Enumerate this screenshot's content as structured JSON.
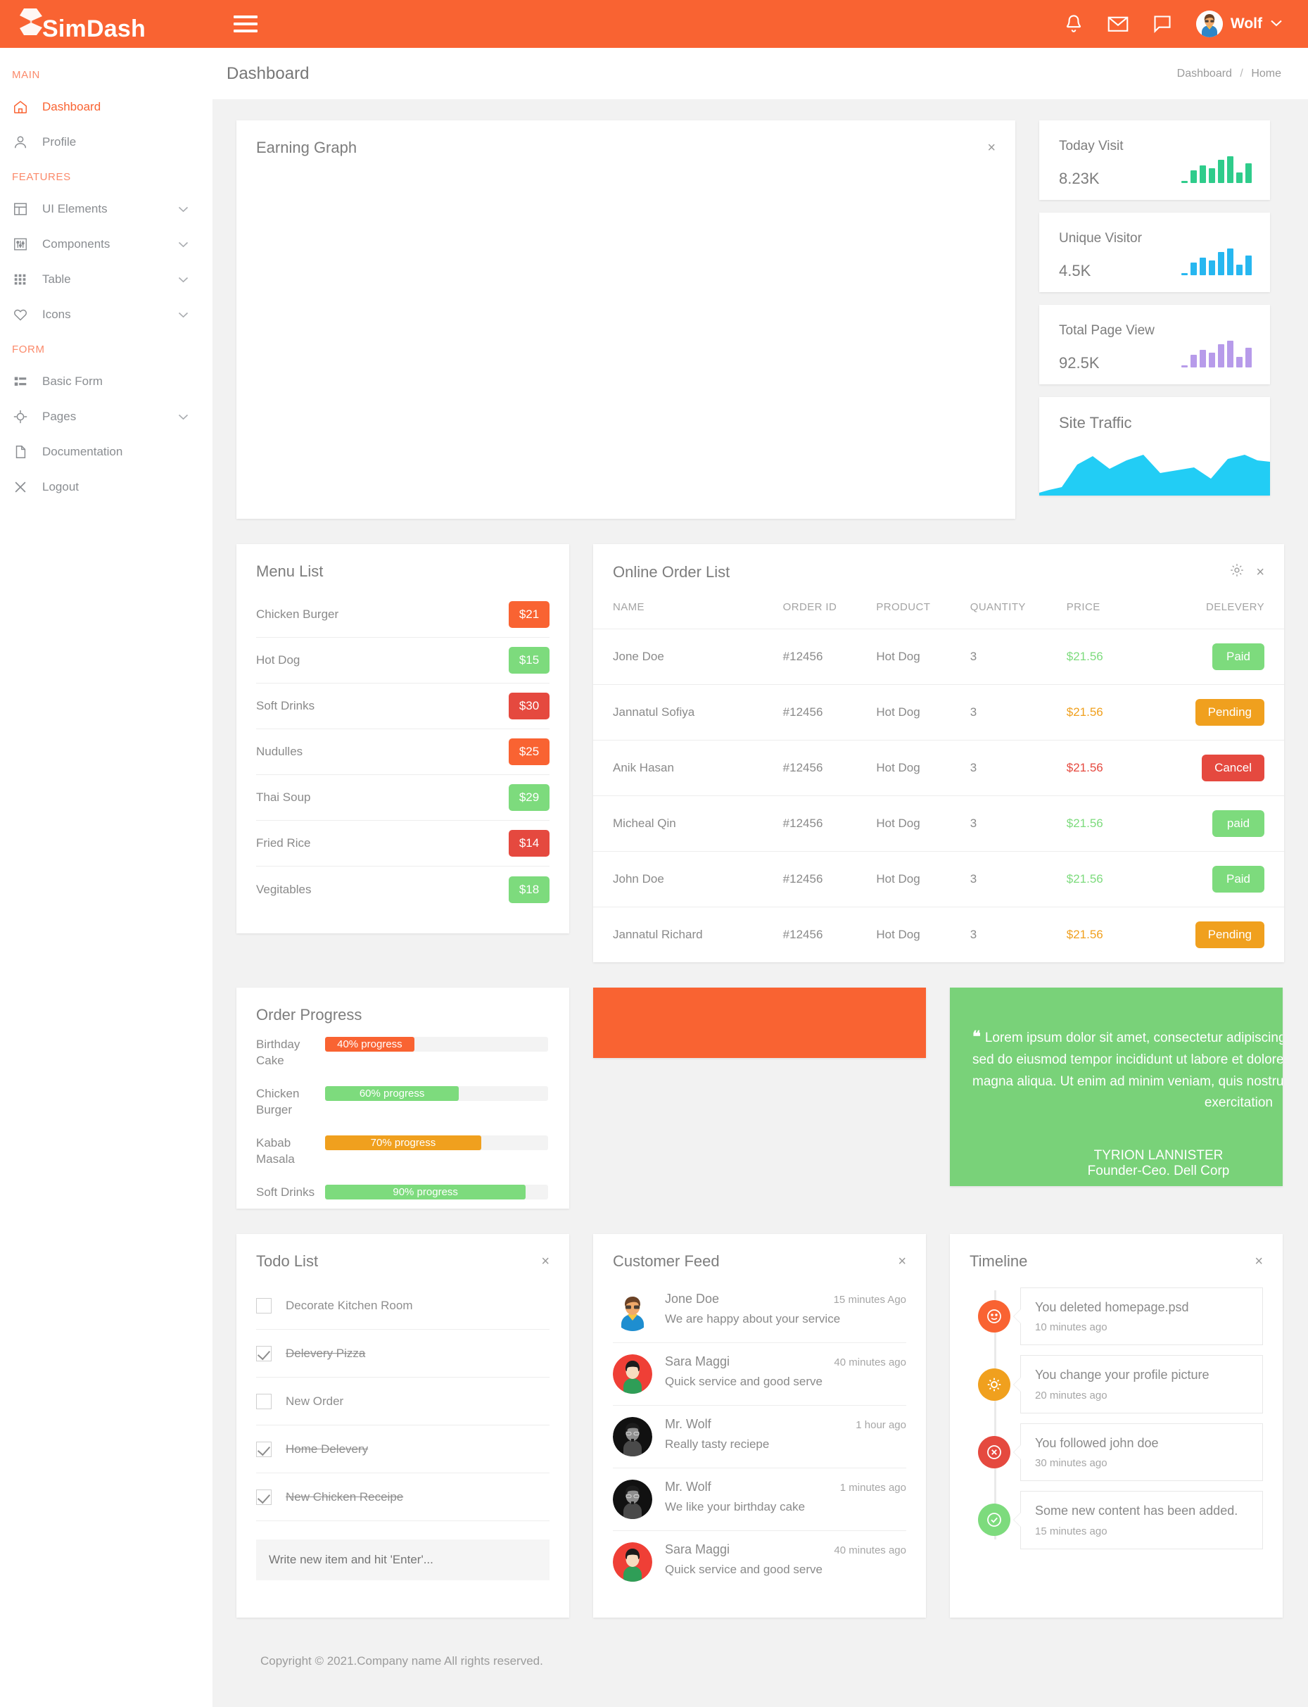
{
  "brand": {
    "logo_first": "Sim",
    "logo_second": "Dash"
  },
  "topbar": {
    "menu_icon": "hamburger-icon",
    "bell_icon": "bell-icon",
    "mail_icon": "mail-icon",
    "chat_icon": "chat-icon",
    "user_name": "Wolf",
    "caret": "∨"
  },
  "sidebar": {
    "sections": [
      {
        "label": "MAIN",
        "items": [
          {
            "label": "Dashboard",
            "icon": "home-icon",
            "active": true,
            "chevron": false
          },
          {
            "label": "Profile",
            "icon": "user-icon",
            "active": false,
            "chevron": false
          }
        ]
      },
      {
        "label": "FEATURES",
        "items": [
          {
            "label": "UI Elements",
            "icon": "layout-icon",
            "active": false,
            "chevron": true
          },
          {
            "label": "Components",
            "icon": "sliders-icon",
            "active": false,
            "chevron": true
          },
          {
            "label": "Table",
            "icon": "grid-icon",
            "active": false,
            "chevron": true
          },
          {
            "label": "Icons",
            "icon": "heart-icon",
            "active": false,
            "chevron": true
          }
        ]
      },
      {
        "label": "FORM",
        "items": [
          {
            "label": "Basic Form",
            "icon": "form-icon",
            "active": false,
            "chevron": false
          },
          {
            "label": "Pages",
            "icon": "target-icon",
            "active": false,
            "chevron": true
          },
          {
            "label": "Documentation",
            "icon": "document-icon",
            "active": false,
            "chevron": false
          },
          {
            "label": "Logout",
            "icon": "close-icon",
            "active": false,
            "chevron": false
          }
        ]
      }
    ]
  },
  "page": {
    "title": "Dashboard",
    "breadcrumb": {
      "parent": "Dashboard",
      "sep": "/",
      "current": "Home"
    }
  },
  "earning_graph": {
    "title": "Earning Graph",
    "close": "×"
  },
  "stats": [
    {
      "label": "Today Visit",
      "value": "8.23K",
      "color": "#2fcc8b"
    },
    {
      "label": "Unique Visitor",
      "value": "4.5K",
      "color": "#27b7f0"
    },
    {
      "label": "Total Page View",
      "value": "92.5K",
      "color": "#b79bea"
    }
  ],
  "site_traffic": {
    "title": "Site Traffic",
    "color": "#22cdf5"
  },
  "menu_list": {
    "title": "Menu List",
    "items": [
      {
        "name": "Chicken Burger",
        "price": "$21",
        "color": "#f96332"
      },
      {
        "name": "Hot Dog",
        "price": "$15",
        "color": "#7ddb7d"
      },
      {
        "name": "Soft Drinks",
        "price": "$30",
        "color": "#e5493f"
      },
      {
        "name": "Nudulles",
        "price": "$25",
        "color": "#f96332"
      },
      {
        "name": "Thai Soup",
        "price": "$29",
        "color": "#7ddb7d"
      },
      {
        "name": "Fried Rice",
        "price": "$14",
        "color": "#e5493f"
      },
      {
        "name": "Vegitables",
        "price": "$18",
        "color": "#7ddb7d"
      }
    ]
  },
  "order_list": {
    "title": "Online Order List",
    "gear_icon": "gear-icon",
    "close": "×",
    "columns": [
      "NAME",
      "ORDER ID",
      "PRODUCT",
      "QUANTITY",
      "PRICE",
      "DELEVERY"
    ],
    "rows": [
      {
        "name": "Jone Doe",
        "order_id": "#12456",
        "product": "Hot Dog",
        "quantity": "3",
        "price": "$21.56",
        "price_color": "#7ddb7d",
        "status": "Paid",
        "status_color": "#7ddb7d"
      },
      {
        "name": "Jannatul Sofiya",
        "order_id": "#12456",
        "product": "Hot Dog",
        "quantity": "3",
        "price": "$21.56",
        "price_color": "#f0a01e",
        "status": "Pending",
        "status_color": "#f0a01e"
      },
      {
        "name": "Anik Hasan",
        "order_id": "#12456",
        "product": "Hot Dog",
        "quantity": "3",
        "price": "$21.56",
        "price_color": "#e5493f",
        "status": "Cancel",
        "status_color": "#e5493f"
      },
      {
        "name": "Micheal Qin",
        "order_id": "#12456",
        "product": "Hot Dog",
        "quantity": "3",
        "price": "$21.56",
        "price_color": "#7ddb7d",
        "status": "paid",
        "status_color": "#7ddb7d"
      },
      {
        "name": "John Doe",
        "order_id": "#12456",
        "product": "Hot Dog",
        "quantity": "3",
        "price": "$21.56",
        "price_color": "#7ddb7d",
        "status": "Paid",
        "status_color": "#7ddb7d"
      },
      {
        "name": "Jannatul Richard",
        "order_id": "#12456",
        "product": "Hot Dog",
        "quantity": "3",
        "price": "$21.56",
        "price_color": "#f0a01e",
        "status": "Pending",
        "status_color": "#f0a01e"
      }
    ]
  },
  "order_progress": {
    "title": "Order Progress",
    "items": [
      {
        "label": "Birthday Cake",
        "text": "40% progress",
        "percent": 40,
        "color": "#f96332"
      },
      {
        "label": "Chicken Burger",
        "text": "60% progress",
        "percent": 60,
        "color": "#7ddb7d"
      },
      {
        "label": "Kabab Masala",
        "text": "70% progress",
        "percent": 70,
        "color": "#f0a01e"
      },
      {
        "label": "Soft Drinks",
        "text": "90% progress",
        "percent": 90,
        "color": "#7ddb7d"
      }
    ]
  },
  "quote": {
    "mark": "“",
    "line1": "Lorem ipsum dolor sit amet, consectetur adipiscing elit,",
    "line2": "sed do eiusmod tempor incididunt ut labore et dolore",
    "line3": "magna aliqua. Ut enim ad minim veniam, quis nostrud",
    "line4": "exercitation",
    "author": "TYRION LANNISTER",
    "role": "Founder-Ceo. Dell Corp"
  },
  "todo": {
    "title": "Todo List",
    "close": "×",
    "items": [
      {
        "text": "Decorate Kitchen Room",
        "checked": false
      },
      {
        "text": "Delevery Pizza",
        "checked": true
      },
      {
        "text": "New Order",
        "checked": false
      },
      {
        "text": "Home Delevery",
        "checked": true
      },
      {
        "text": "New Chicken Receipe",
        "checked": true
      }
    ],
    "input_placeholder": "Write new item and hit 'Enter'...",
    "input_value": ""
  },
  "customer_feed": {
    "title": "Customer Feed",
    "close": "×",
    "items": [
      {
        "name": "Jone Doe",
        "time": "15 minutes Ago",
        "message": "We are happy about your service",
        "avatar": "avatar-glasses-blue"
      },
      {
        "name": "Sara Maggi",
        "time": "40 minutes ago",
        "message": "Quick service and good serve",
        "avatar": "avatar-red"
      },
      {
        "name": "Mr. Wolf",
        "time": "1 hour ago",
        "message": "Really tasty reciepe",
        "avatar": "avatar-dark"
      },
      {
        "name": "Mr. Wolf",
        "time": "1 minutes ago",
        "message": "We like your birthday cake",
        "avatar": "avatar-dark"
      },
      {
        "name": "Sara Maggi",
        "time": "40 minutes ago",
        "message": "Quick service and good serve",
        "avatar": "avatar-red"
      }
    ]
  },
  "timeline": {
    "title": "Timeline",
    "close": "×",
    "items": [
      {
        "title": "You deleted homepage.psd",
        "time": "10 minutes ago",
        "color": "#f96332",
        "icon": "smiley-icon"
      },
      {
        "title": "You change your profile picture",
        "time": "20 minutes ago",
        "color": "#f0a01e",
        "icon": "sun-icon"
      },
      {
        "title": "You followed john doe",
        "time": "30 minutes ago",
        "color": "#e5493f",
        "icon": "close-circle-icon"
      },
      {
        "title": "Some new content has been added.",
        "time": "15 minutes ago",
        "color": "#7ddb7d",
        "icon": "check-circle-icon"
      }
    ]
  },
  "footer": {
    "text": "Copyright © 2021.Company name All rights reserved."
  },
  "chart_data": [
    {
      "type": "bar",
      "title": "Today Visit",
      "values": [
        4,
        22,
        30,
        26,
        40,
        45,
        18,
        33
      ],
      "color": "#2fcc8b",
      "ylabel": "",
      "xlabel": ""
    },
    {
      "type": "bar",
      "title": "Unique Visitor",
      "values": [
        4,
        22,
        30,
        26,
        40,
        45,
        18,
        33
      ],
      "color": "#27b7f0",
      "ylabel": "",
      "xlabel": ""
    },
    {
      "type": "bar",
      "title": "Total Page View",
      "values": [
        4,
        22,
        30,
        26,
        40,
        45,
        18,
        33
      ],
      "color": "#b79bea",
      "ylabel": "",
      "xlabel": ""
    },
    {
      "type": "area",
      "title": "Site Traffic",
      "x": [
        0,
        1,
        2,
        3,
        4,
        5,
        6,
        7,
        8,
        9,
        10,
        11
      ],
      "values": [
        4,
        10,
        52,
        70,
        48,
        38,
        62,
        30,
        36,
        22,
        66,
        44
      ],
      "color": "#22cdf5",
      "ylabel": "",
      "xlabel": ""
    },
    {
      "type": "line",
      "title": "Earning Graph",
      "x": [],
      "values": [],
      "note": "empty plot area",
      "ylabel": "",
      "xlabel": ""
    }
  ]
}
